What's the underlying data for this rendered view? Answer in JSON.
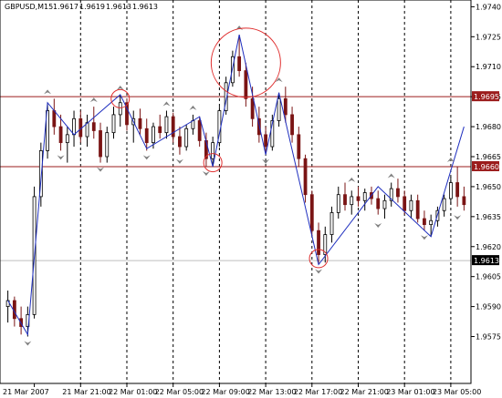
{
  "header": {
    "symbol": "GBPUSD,M15",
    "open": "1.9617",
    "high": "1.9619",
    "low": "1.9613",
    "close": "1.9613"
  },
  "chart_data": {
    "type": "candlestick",
    "symbol": "GBPUSD",
    "timeframe": "M15",
    "ylim": [
      1.9552,
      1.9742
    ],
    "y_ticks": [
      "1.9740",
      "1.9725",
      "1.9710",
      "1.9695",
      "1.9680",
      "1.9665",
      "1.9650",
      "1.9635",
      "1.9620",
      "1.9605",
      "1.9590",
      "1.9575"
    ],
    "x_ticks": [
      "21 Mar 2007",
      "21 Mar 21:00",
      "22 Mar 01:00",
      "22 Mar 05:00",
      "22 Mar 09:00",
      "22 Mar 13:00",
      "22 Mar 17:00",
      "22 Mar 21:00",
      "23 Mar 01:00",
      "23 Mar 05:00"
    ],
    "horizontal_levels": [
      {
        "value": 1.9695,
        "label": "1.9695",
        "color": "#9b1c1c"
      },
      {
        "value": 1.966,
        "label": "1.9660",
        "color": "#9b1c1c"
      },
      {
        "value": 1.9613,
        "label": "1.9613",
        "color": "#bfbfbf"
      }
    ],
    "bull_color": "#000000",
    "bear_color": "#7a1414",
    "zigzag_color": "#1f2fbf",
    "circle_color": "#e03030",
    "candles": [
      [
        1.959,
        1.9598,
        1.9582,
        1.9593
      ],
      [
        1.9593,
        1.9595,
        1.958,
        1.9584
      ],
      [
        1.9584,
        1.959,
        1.9576,
        1.958
      ],
      [
        1.958,
        1.959,
        1.9575,
        1.9586
      ],
      [
        1.9586,
        1.965,
        1.9584,
        1.9645
      ],
      [
        1.9645,
        1.9672,
        1.964,
        1.9668
      ],
      [
        1.9668,
        1.9692,
        1.9664,
        1.9688
      ],
      [
        1.9688,
        1.9694,
        1.9676,
        1.968
      ],
      [
        1.968,
        1.9686,
        1.9668,
        1.9672
      ],
      [
        1.9672,
        1.968,
        1.9662,
        1.9676
      ],
      [
        1.9676,
        1.9688,
        1.967,
        1.9684
      ],
      [
        1.9684,
        1.9688,
        1.9672,
        1.9675
      ],
      [
        1.9675,
        1.9686,
        1.967,
        1.9682
      ],
      [
        1.9682,
        1.969,
        1.9674,
        1.9678
      ],
      [
        1.9678,
        1.9682,
        1.9662,
        1.9665
      ],
      [
        1.9665,
        1.968,
        1.9662,
        1.9677
      ],
      [
        1.9677,
        1.969,
        1.9674,
        1.9686
      ],
      [
        1.9686,
        1.9696,
        1.968,
        1.9692
      ],
      [
        1.9692,
        1.9694,
        1.9678,
        1.9681
      ],
      [
        1.9681,
        1.9688,
        1.9672,
        1.9684
      ],
      [
        1.9684,
        1.9689,
        1.9676,
        1.9679
      ],
      [
        1.9679,
        1.9684,
        1.9668,
        1.9672
      ],
      [
        1.9672,
        1.9682,
        1.9669,
        1.968
      ],
      [
        1.968,
        1.9686,
        1.9674,
        1.9677
      ],
      [
        1.9677,
        1.9688,
        1.9674,
        1.9685
      ],
      [
        1.9685,
        1.9687,
        1.9672,
        1.9675
      ],
      [
        1.9675,
        1.968,
        1.9666,
        1.967
      ],
      [
        1.967,
        1.9681,
        1.9668,
        1.9679
      ],
      [
        1.9679,
        1.9686,
        1.9676,
        1.9683
      ],
      [
        1.9683,
        1.9685,
        1.967,
        1.9673
      ],
      [
        1.9673,
        1.9677,
        1.966,
        1.9664
      ],
      [
        1.9664,
        1.9675,
        1.966,
        1.9672
      ],
      [
        1.9672,
        1.969,
        1.967,
        1.9688
      ],
      [
        1.9688,
        1.9705,
        1.9686,
        1.9702
      ],
      [
        1.9702,
        1.9718,
        1.97,
        1.9715
      ],
      [
        1.9715,
        1.9726,
        1.9705,
        1.9708
      ],
      [
        1.9708,
        1.9712,
        1.969,
        1.9694
      ],
      [
        1.9694,
        1.97,
        1.968,
        1.9684
      ],
      [
        1.9684,
        1.969,
        1.9672,
        1.9676
      ],
      [
        1.9676,
        1.968,
        1.9666,
        1.967
      ],
      [
        1.967,
        1.9686,
        1.9668,
        1.9683
      ],
      [
        1.9683,
        1.9697,
        1.968,
        1.9694
      ],
      [
        1.9694,
        1.97,
        1.9682,
        1.9686
      ],
      [
        1.9686,
        1.969,
        1.9672,
        1.9676
      ],
      [
        1.9676,
        1.968,
        1.966,
        1.9664
      ],
      [
        1.9664,
        1.9666,
        1.9642,
        1.9646
      ],
      [
        1.9646,
        1.9648,
        1.9625,
        1.9628
      ],
      [
        1.9628,
        1.9632,
        1.9611,
        1.9616
      ],
      [
        1.9616,
        1.963,
        1.9612,
        1.9626
      ],
      [
        1.9626,
        1.964,
        1.9622,
        1.9637
      ],
      [
        1.9637,
        1.965,
        1.9634,
        1.9646
      ],
      [
        1.9646,
        1.9652,
        1.9638,
        1.9641
      ],
      [
        1.9641,
        1.9648,
        1.9636,
        1.9645
      ],
      [
        1.9645,
        1.965,
        1.964,
        1.9643
      ],
      [
        1.9643,
        1.9649,
        1.9638,
        1.9647
      ],
      [
        1.9647,
        1.965,
        1.9641,
        1.9644
      ],
      [
        1.9644,
        1.9648,
        1.9636,
        1.9639
      ],
      [
        1.9639,
        1.9646,
        1.9634,
        1.9643
      ],
      [
        1.9643,
        1.9652,
        1.964,
        1.9649
      ],
      [
        1.9649,
        1.9654,
        1.9642,
        1.9645
      ],
      [
        1.9645,
        1.9648,
        1.9636,
        1.9638
      ],
      [
        1.9638,
        1.9646,
        1.9634,
        1.9643
      ],
      [
        1.9643,
        1.9646,
        1.9632,
        1.9634
      ],
      [
        1.9634,
        1.9638,
        1.9628,
        1.9631
      ],
      [
        1.9631,
        1.9636,
        1.9625,
        1.9633
      ],
      [
        1.9633,
        1.964,
        1.963,
        1.9638
      ],
      [
        1.9638,
        1.9646,
        1.9635,
        1.9644
      ],
      [
        1.9644,
        1.9655,
        1.9641,
        1.9652
      ],
      [
        1.9652,
        1.966,
        1.964,
        1.9645
      ],
      [
        1.9645,
        1.965,
        1.9638,
        1.9641
      ]
    ],
    "zigzag": [
      [
        0,
        1.9593
      ],
      [
        3,
        1.9576
      ],
      [
        6,
        1.9692
      ],
      [
        10,
        1.9676
      ],
      [
        17,
        1.9696
      ],
      [
        21,
        1.9669
      ],
      [
        29,
        1.9685
      ],
      [
        31,
        1.966
      ],
      [
        35,
        1.9726
      ],
      [
        39,
        1.9666
      ],
      [
        41,
        1.9697
      ],
      [
        47,
        1.9611
      ],
      [
        56,
        1.965
      ],
      [
        64,
        1.9625
      ],
      [
        69,
        1.968
      ]
    ],
    "circles": [
      {
        "index": 17,
        "price": 1.9694
      },
      {
        "index": 31,
        "price": 1.9662
      },
      {
        "index": 36,
        "price": 1.9712
      },
      {
        "index": 47,
        "price": 1.9614
      }
    ],
    "up_fractals": [
      [
        6,
        1.9694
      ],
      [
        13,
        1.969
      ],
      [
        17,
        1.9696
      ],
      [
        24,
        1.9688
      ],
      [
        28,
        1.9686
      ],
      [
        35,
        1.9726
      ],
      [
        41,
        1.97
      ],
      [
        52,
        1.965
      ],
      [
        58,
        1.9652
      ],
      [
        67,
        1.966
      ]
    ],
    "down_fractals": [
      [
        3,
        1.9575
      ],
      [
        8,
        1.9668
      ],
      [
        14,
        1.9662
      ],
      [
        21,
        1.9668
      ],
      [
        26,
        1.9666
      ],
      [
        30,
        1.966
      ],
      [
        39,
        1.9666
      ],
      [
        47,
        1.9611
      ],
      [
        56,
        1.9634
      ],
      [
        63,
        1.9628
      ],
      [
        68,
        1.9638
      ]
    ]
  }
}
